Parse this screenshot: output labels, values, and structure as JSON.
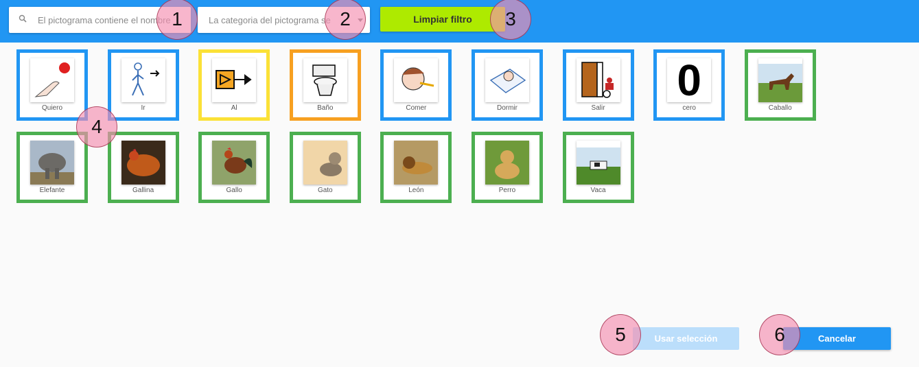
{
  "colors": {
    "topbar": "#2196f3",
    "clear_button": "#aeea00",
    "cancel_button": "#2196f3",
    "use_button_disabled": "#bbdefb",
    "border_blue": "#2196f3",
    "border_yellow": "#fbe137",
    "border_orange": "#f7a021",
    "border_green": "#4caf50",
    "marker": "#f48fb1"
  },
  "toolbar": {
    "search_placeholder": "El pictograma contiene el nombre",
    "search_icon": "search-icon",
    "category_placeholder": "La categoria del pictograma se",
    "category_caret_icon": "caret-down-icon",
    "clear_label": "Limpiar filtro"
  },
  "pictograms": [
    {
      "label": "Quiero",
      "border": "blue",
      "icon": "want-hand-icon"
    },
    {
      "label": "Ir",
      "border": "blue",
      "icon": "walk-icon"
    },
    {
      "label": "Al",
      "border": "yellow",
      "icon": "to-arrow-icon"
    },
    {
      "label": "Baño",
      "border": "orange",
      "icon": "toilet-icon"
    },
    {
      "label": "Comer",
      "border": "blue",
      "icon": "eat-icon"
    },
    {
      "label": "Dormir",
      "border": "blue",
      "icon": "sleep-icon"
    },
    {
      "label": "Salir",
      "border": "blue",
      "icon": "exit-door-icon"
    },
    {
      "label": "cero",
      "border": "blue",
      "icon": "zero-digit-icon",
      "digit": "0"
    },
    {
      "label": "Caballo",
      "border": "green",
      "icon": "horse-photo"
    },
    {
      "label": "Elefante",
      "border": "green",
      "icon": "elephant-photo"
    },
    {
      "label": "Gallina",
      "border": "green",
      "icon": "hen-photo"
    },
    {
      "label": "Gallo",
      "border": "green",
      "icon": "rooster-photo"
    },
    {
      "label": "Gato",
      "border": "green",
      "icon": "cat-photo"
    },
    {
      "label": "León",
      "border": "green",
      "icon": "lion-photo"
    },
    {
      "label": "Perro",
      "border": "green",
      "icon": "dog-photo"
    },
    {
      "label": "Vaca",
      "border": "green",
      "icon": "cow-photo"
    }
  ],
  "actions": {
    "use_selection_label": "Usar selección",
    "cancel_label": "Cancelar"
  },
  "markers": [
    "1",
    "2",
    "3",
    "4",
    "5",
    "6"
  ]
}
